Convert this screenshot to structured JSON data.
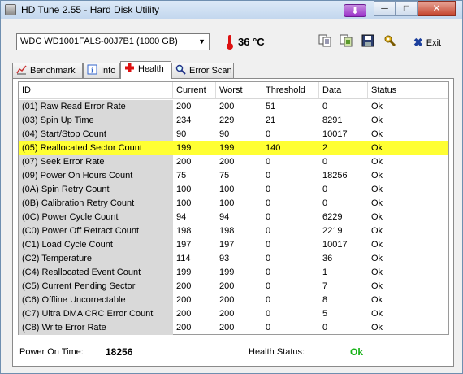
{
  "window": {
    "title": "HD Tune 2.55 - Hard Disk Utility",
    "special_button_glyph": "⬇",
    "caption_buttons": [
      "─",
      "□",
      "✕"
    ]
  },
  "toolbar": {
    "drive": "WDC WD1001FALS-00J7B1 (1000 GB)",
    "temperature": "36 °C",
    "exit_label": "Exit"
  },
  "tabs": [
    {
      "label": "Benchmark",
      "icon": "benchmark-icon"
    },
    {
      "label": "Info",
      "icon": "info-icon"
    },
    {
      "label": "Health",
      "icon": "health-cross-icon",
      "active": true
    },
    {
      "label": "Error Scan",
      "icon": "magnifier-icon"
    }
  ],
  "table": {
    "columns": [
      "ID",
      "Current",
      "Worst",
      "Threshold",
      "Data",
      "Status"
    ],
    "rows": [
      [
        "(01) Raw Read Error Rate",
        "200",
        "200",
        "51",
        "0",
        "Ok"
      ],
      [
        "(03) Spin Up Time",
        "234",
        "229",
        "21",
        "8291",
        "Ok"
      ],
      [
        "(04) Start/Stop Count",
        "90",
        "90",
        "0",
        "10017",
        "Ok"
      ],
      [
        "(05) Reallocated Sector Count",
        "199",
        "199",
        "140",
        "2",
        "Ok"
      ],
      [
        "(07) Seek Error Rate",
        "200",
        "200",
        "0",
        "0",
        "Ok"
      ],
      [
        "(09) Power On Hours Count",
        "75",
        "75",
        "0",
        "18256",
        "Ok"
      ],
      [
        "(0A) Spin Retry Count",
        "100",
        "100",
        "0",
        "0",
        "Ok"
      ],
      [
        "(0B) Calibration Retry Count",
        "100",
        "100",
        "0",
        "0",
        "Ok"
      ],
      [
        "(0C) Power Cycle Count",
        "94",
        "94",
        "0",
        "6229",
        "Ok"
      ],
      [
        "(C0) Power Off Retract Count",
        "198",
        "198",
        "0",
        "2219",
        "Ok"
      ],
      [
        "(C1) Load Cycle Count",
        "197",
        "197",
        "0",
        "10017",
        "Ok"
      ],
      [
        "(C2) Temperature",
        "114",
        "93",
        "0",
        "36",
        "Ok"
      ],
      [
        "(C4) Reallocated Event Count",
        "199",
        "199",
        "0",
        "1",
        "Ok"
      ],
      [
        "(C5) Current Pending Sector",
        "200",
        "200",
        "0",
        "7",
        "Ok"
      ],
      [
        "(C6) Offline Uncorrectable",
        "200",
        "200",
        "0",
        "8",
        "Ok"
      ],
      [
        "(C7) Ultra DMA CRC Error Count",
        "200",
        "200",
        "0",
        "5",
        "Ok"
      ],
      [
        "(C8) Write Error Rate",
        "200",
        "200",
        "0",
        "0",
        "Ok"
      ]
    ],
    "highlighted_row": 3,
    "highlight_color": "#ffff33"
  },
  "footer": {
    "power_on_label": "Power On Time:",
    "power_on_value": "18256",
    "health_label": "Health Status:",
    "health_value": "Ok",
    "health_color": "#17b217"
  }
}
